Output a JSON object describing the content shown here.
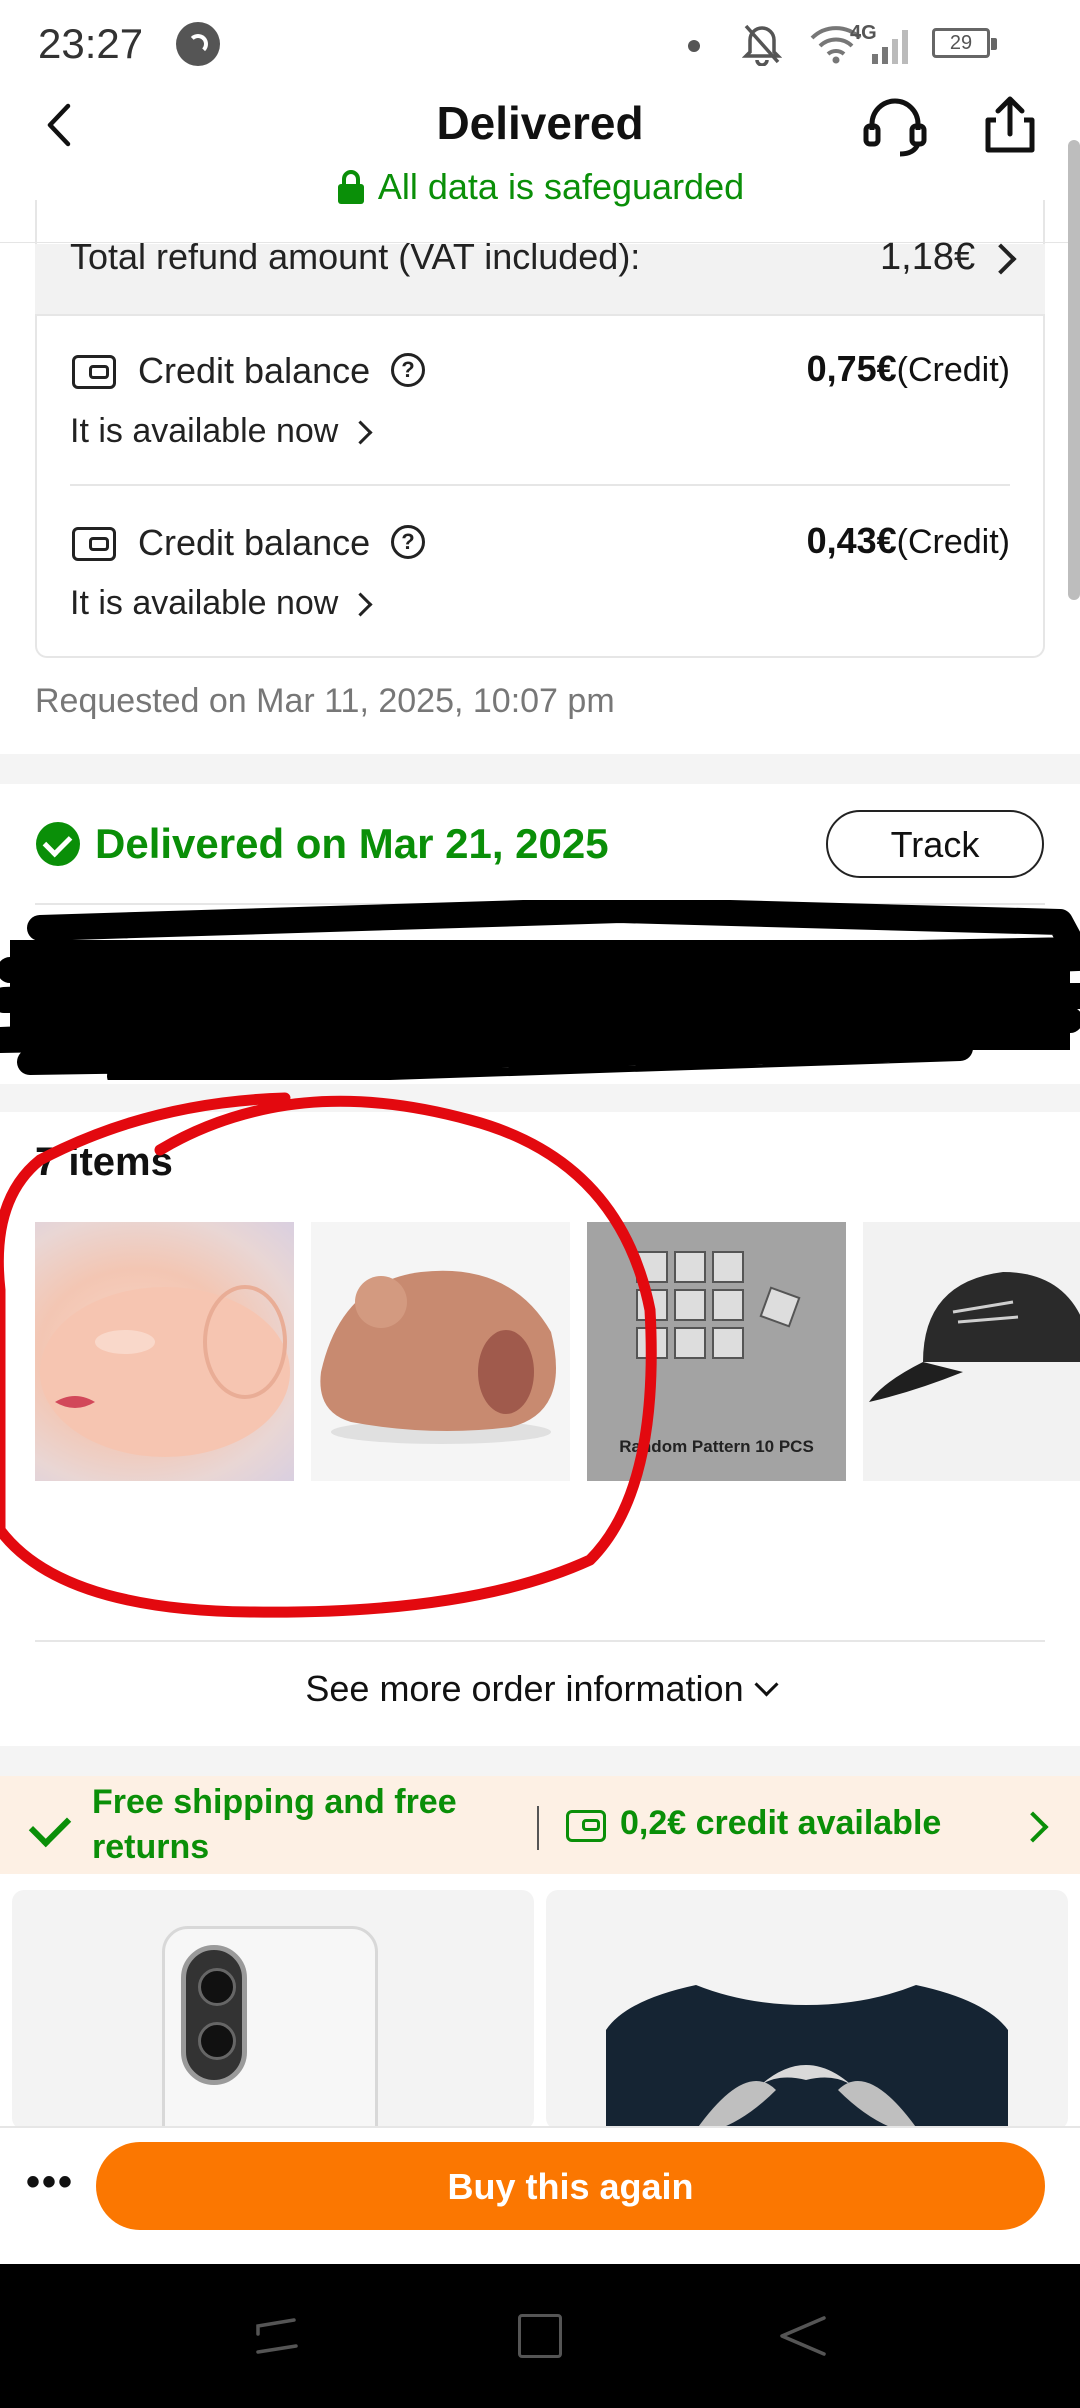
{
  "status_bar": {
    "time": "23:27",
    "network": "4G",
    "battery": "29"
  },
  "header": {
    "title": "Delivered",
    "safeguard_text": "All data is safeguarded"
  },
  "refund": {
    "total_label": "Total refund amount (VAT included):",
    "total_value": "1,18€",
    "credits": [
      {
        "label": "Credit balance",
        "amount": "0,75€",
        "suffix": "(Credit)",
        "availability": "It is available now"
      },
      {
        "label": "Credit balance",
        "amount": "0,43€",
        "suffix": "(Credit)",
        "availability": "It is available now"
      }
    ],
    "requested": "Requested on Mar 11, 2025, 10:07 pm"
  },
  "delivery": {
    "status": "Delivered on Mar 21, 2025",
    "track_label": "Track"
  },
  "items": {
    "count_label": "7 items",
    "thumbnail_caption": "Random Pattern 10 PCS"
  },
  "more_info_label": "See more order information",
  "promo": {
    "shipping_text": "Free shipping and free returns",
    "credit_text": "0,2€ credit available"
  },
  "actions": {
    "buy_again_label": "Buy this again"
  },
  "colors": {
    "accent_green": "#0a8f08",
    "primary_orange": "#fb7701",
    "promo_background": "#fdf0e4",
    "annotation_red": "#e3090f"
  }
}
